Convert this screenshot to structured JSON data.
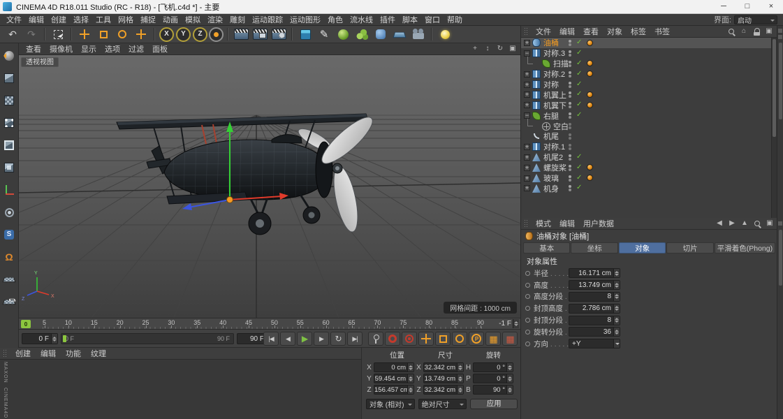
{
  "window": {
    "title": "CINEMA 4D R18.011 Studio (RC - R18) - [飞机.c4d *] - 主要",
    "controls": [
      {
        "name": "minimize-button",
        "glyph": "─"
      },
      {
        "name": "maximize-button",
        "glyph": "□"
      },
      {
        "name": "close-button",
        "glyph": "×"
      }
    ]
  },
  "menubar": {
    "items": [
      "文件",
      "编辑",
      "创建",
      "选择",
      "工具",
      "网格",
      "捕捉",
      "动画",
      "模拟",
      "渲染",
      "雕刻",
      "运动跟踪",
      "运动图形",
      "角色",
      "流水线",
      "插件",
      "脚本",
      "窗口",
      "帮助"
    ],
    "interface_label": "界面:",
    "interface_value": "启动"
  },
  "toolbar": {
    "buttons": [
      {
        "name": "undo-button",
        "glyph": "↶"
      },
      {
        "name": "redo-button",
        "glyph": "↷"
      },
      {
        "name": "separator",
        "sep": true
      },
      {
        "name": "live-selection-tool"
      },
      {
        "name": "separator",
        "sep": true
      },
      {
        "name": "move-tool"
      },
      {
        "name": "scale-tool"
      },
      {
        "name": "rotate-tool"
      },
      {
        "name": "last-used-tool"
      },
      {
        "name": "separator",
        "sep": true
      },
      {
        "name": "lock-x-axis",
        "glyph": "X"
      },
      {
        "name": "lock-y-axis",
        "glyph": "Y"
      },
      {
        "name": "lock-z-axis",
        "glyph": "Z"
      },
      {
        "name": "coordinate-system-toggle"
      },
      {
        "name": "separator",
        "sep": true
      },
      {
        "name": "render-view-button"
      },
      {
        "name": "render-picture-viewer-button"
      },
      {
        "name": "render-settings-button"
      },
      {
        "name": "separator",
        "sep": true
      },
      {
        "name": "add-primitive-button"
      },
      {
        "name": "spline-pen-button",
        "glyph": "✎"
      },
      {
        "name": "subdivision-surface-button"
      },
      {
        "name": "mograph-button"
      },
      {
        "name": "deformer-button"
      },
      {
        "name": "environment-button"
      },
      {
        "name": "camera-button"
      },
      {
        "name": "separator",
        "sep": true
      },
      {
        "name": "light-button"
      }
    ]
  },
  "left_toolbar": {
    "tools": [
      {
        "name": "make-editable-button"
      },
      {
        "name": "model-mode-button"
      },
      {
        "name": "texture-mode-button"
      },
      {
        "name": "points-mode-button"
      },
      {
        "name": "edges-mode-button"
      },
      {
        "name": "polygons-mode-button"
      },
      {
        "name": "enable-axis-button"
      },
      {
        "name": "viewport-solo-button"
      },
      {
        "name": "enable-snap-button",
        "glyph": "S"
      },
      {
        "name": "enable-quantizing-button",
        "glyph": "Ω"
      },
      {
        "name": "workplane-mode-button"
      },
      {
        "name": "lock-workplane-button"
      }
    ]
  },
  "viewport": {
    "menu": [
      "查看",
      "摄像机",
      "显示",
      "选项",
      "过滤",
      "面板"
    ],
    "nav_icons": [
      {
        "name": "pan-view-icon",
        "glyph": "+"
      },
      {
        "name": "zoom-view-icon",
        "glyph": "↕"
      },
      {
        "name": "rotate-view-icon",
        "glyph": "↻"
      },
      {
        "name": "maximize-view-icon",
        "glyph": "▣"
      }
    ],
    "view_label": "透视视图",
    "grid_badge": "网格间距 : 1000 cm"
  },
  "timeline": {
    "marker_label": "0",
    "ticks": [
      "5",
      "10",
      "15",
      "20",
      "25",
      "30",
      "35",
      "40",
      "45",
      "50",
      "55",
      "60",
      "65",
      "70",
      "75",
      "80",
      "85",
      "90"
    ],
    "offset_field": "-1 F",
    "current_frame_field": "0 F",
    "slider_start_label": "0 F",
    "slider_end_label": "90 F",
    "end_frame_field": "90 F",
    "transport": [
      {
        "name": "goto-start-button",
        "glyph": "|◀"
      },
      {
        "name": "prev-frame-button",
        "glyph": "◀"
      },
      {
        "name": "play-button",
        "glyph": "▶",
        "play": true
      },
      {
        "name": "next-frame-button",
        "glyph": "▶"
      },
      {
        "name": "play-mode-button",
        "glyph": "↻"
      },
      {
        "name": "goto-end-button",
        "glyph": "▶|"
      }
    ],
    "record_buttons": [
      {
        "name": "record-keyframe-button"
      },
      {
        "name": "autokey-button"
      },
      {
        "name": "keyframe-selection-button"
      }
    ],
    "record_toggles": [
      {
        "name": "record-position-toggle"
      },
      {
        "name": "record-scale-toggle"
      },
      {
        "name": "record-rotation-toggle"
      },
      {
        "name": "record-parameter-toggle",
        "glyph": "P"
      },
      {
        "name": "record-pla-toggle",
        "glyph": "▦"
      },
      {
        "name": "record-reduced-toggle",
        "glyph": "▦"
      }
    ]
  },
  "materials_manager": {
    "menu": [
      "创建",
      "编辑",
      "功能",
      "纹理"
    ],
    "brand_top": "MAXON",
    "brand_bottom": "CINEMA4D"
  },
  "coordinate_manager": {
    "groups": [
      "位置",
      "尺寸",
      "旋转"
    ],
    "rows": [
      {
        "a": "X",
        "av": "0 cm",
        "b": "X",
        "bv": "32.342 cm",
        "c": "H",
        "cv": "0 °"
      },
      {
        "a": "Y",
        "av": "59.454 cm",
        "b": "Y",
        "bv": "13.749 cm",
        "c": "P",
        "cv": "0 °"
      },
      {
        "a": "Z",
        "av": "156.457 cm",
        "b": "Z",
        "bv": "32.342 cm",
        "c": "B",
        "cv": "90 °"
      }
    ],
    "mode_select": "对象 (相对)",
    "size_select": "绝对尺寸",
    "apply_label": "应用"
  },
  "object_manager": {
    "menu": [
      "文件",
      "编辑",
      "查看",
      "对象",
      "标签",
      "书签"
    ],
    "right_icons": [
      {
        "name": "search-icon"
      },
      {
        "name": "home-icon",
        "glyph": "⌂"
      },
      {
        "name": "lock-icon"
      },
      {
        "name": "panel-icon",
        "glyph": "▣"
      }
    ],
    "objects": [
      {
        "label": "油桶",
        "icon": "oiltank",
        "selected": true,
        "expander": true,
        "check": true,
        "material": true
      },
      {
        "label": "对称.3",
        "icon": "symmetry",
        "expander": true,
        "expanded": true,
        "check": true
      },
      {
        "label": "扫描",
        "icon": "sweep",
        "child": true,
        "check": true,
        "material": true
      },
      {
        "label": "对称.2",
        "icon": "symmetry",
        "expander": true,
        "check": true,
        "material": true
      },
      {
        "label": "对称",
        "icon": "symmetry",
        "expander": true,
        "check": true
      },
      {
        "label": "机翼上",
        "icon": "symmetry",
        "expander": true,
        "check": true,
        "material": true
      },
      {
        "label": "机翼下",
        "icon": "symmetry",
        "expander": true,
        "check": true,
        "material": true
      },
      {
        "label": "右腿",
        "icon": "sweep",
        "expander": true,
        "expanded": true,
        "check": true
      },
      {
        "label": "空白",
        "icon": "null",
        "child": true,
        "nocheck": true
      },
      {
        "label": "机尾",
        "icon": "spline",
        "nocheck": true
      },
      {
        "label": "对称.1",
        "icon": "symmetry",
        "expander": true,
        "nocheck": true
      },
      {
        "label": "机尾2",
        "icon": "mesh",
        "expander": true,
        "check": true
      },
      {
        "label": "螺旋桨",
        "icon": "mesh",
        "expander": true,
        "check": true,
        "material": true
      },
      {
        "label": "玻璃",
        "icon": "mesh",
        "expander": true,
        "check": true,
        "material": true
      },
      {
        "label": "机身",
        "icon": "mesh",
        "expander": true,
        "check": true
      }
    ]
  },
  "attribute_manager": {
    "menu": [
      "模式",
      "编辑",
      "用户数据"
    ],
    "right_icons": [
      {
        "name": "back-icon",
        "glyph": "◀"
      },
      {
        "name": "forward-icon",
        "glyph": "▶"
      },
      {
        "name": "up-icon",
        "glyph": "▲"
      },
      {
        "name": "search-icon"
      },
      {
        "name": "panel-icon",
        "glyph": "▣"
      }
    ],
    "title": "油桶对象 [油桶]",
    "tabs": [
      {
        "label": "基本"
      },
      {
        "label": "坐标"
      },
      {
        "label": "对象",
        "active": true
      },
      {
        "label": "切片"
      },
      {
        "label": "平滑着色(Phong)"
      }
    ],
    "section": "对象属性",
    "params": [
      {
        "label": "半径",
        "value": "16.171 cm"
      },
      {
        "label": "高度",
        "value": "13.749 cm"
      },
      {
        "label": "高度分段",
        "value": "8"
      },
      {
        "label": "封顶高度",
        "value": "2.786 cm"
      },
      {
        "label": "封顶分段",
        "value": "8"
      },
      {
        "label": "旋转分段",
        "value": "36"
      },
      {
        "label": "方向",
        "value": "+Y",
        "dropdown": true
      }
    ]
  }
}
